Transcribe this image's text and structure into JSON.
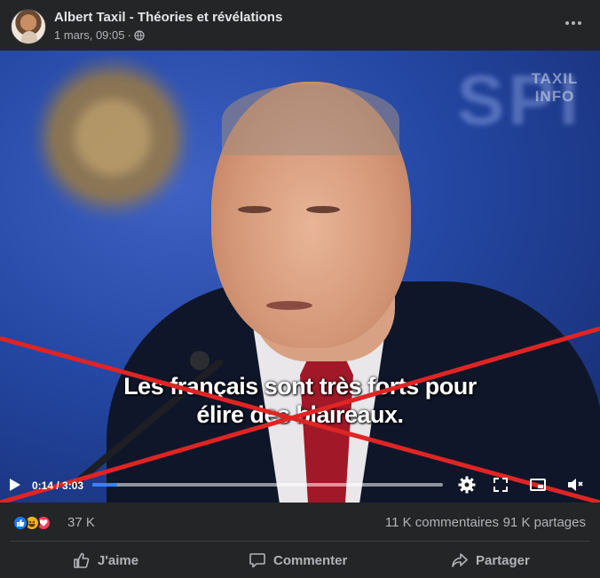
{
  "post": {
    "author": "Albert Taxil - Théories et révélations",
    "timestamp": "1 mars, 09:05",
    "separator": "·",
    "more_icon": "more-horizontal-icon"
  },
  "video": {
    "watermark_line1": "TAXIL",
    "watermark_line2": "INFO",
    "subtitle_line1": "Les français sont très forts pour",
    "subtitle_line2": "élire des blaireaux.",
    "time": "0:14 / 3:03",
    "progress": 0.07,
    "cross_color": "#e02424",
    "accent": "#2d88ff"
  },
  "stats": {
    "reaction_count": "37 K",
    "comments": "11 K commentaires",
    "shares": "91 K partages",
    "reactions": [
      "like",
      "haha",
      "love"
    ]
  },
  "actions": {
    "like": "J'aime",
    "comment": "Commenter",
    "share": "Partager"
  }
}
